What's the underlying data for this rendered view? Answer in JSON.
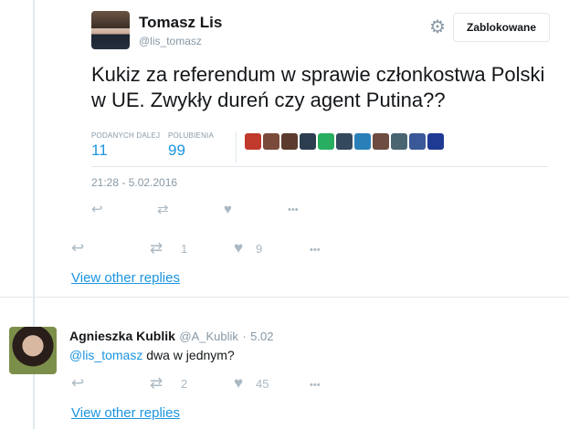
{
  "embedded_tweet": {
    "author_name": "Tomasz Lis",
    "author_handle": "@lis_tomasz",
    "block_button": "Zablokowane",
    "text": "Kukiz za referendum w sprawie członkostwa Polski w UE. Zwykły dureń czy agent Putina??",
    "retweets_label": "PODANYCH DALEJ",
    "retweets_count": "11",
    "likes_label": "POLUBIENIA",
    "likes_count": "99",
    "timestamp": "21:28 - 5.02.2016",
    "liker_colors": [
      "#c0392b",
      "#7a4a3a",
      "#5b3b2e",
      "#2c3e50",
      "#27ae60",
      "#34495e",
      "#2980b9",
      "#6d4c41",
      "#4a6572",
      "#3b5998",
      "#1f3a93"
    ]
  },
  "outer_actions": {
    "retweet_count": "1",
    "like_count": "9"
  },
  "view_replies_1": "View other replies",
  "reply": {
    "author_name": "Agnieszka Kublik",
    "author_handle": "@A_Kublik",
    "separator": "·",
    "date": "5.02",
    "mention": "@lis_tomasz",
    "text": " dwa w jednym?",
    "retweet_count": "2",
    "like_count": "45"
  },
  "view_replies_2": "View other replies",
  "icons": {
    "reply": "↩",
    "retweet": "⇄",
    "like": "♥",
    "more": "•••",
    "gear": "⚙"
  }
}
